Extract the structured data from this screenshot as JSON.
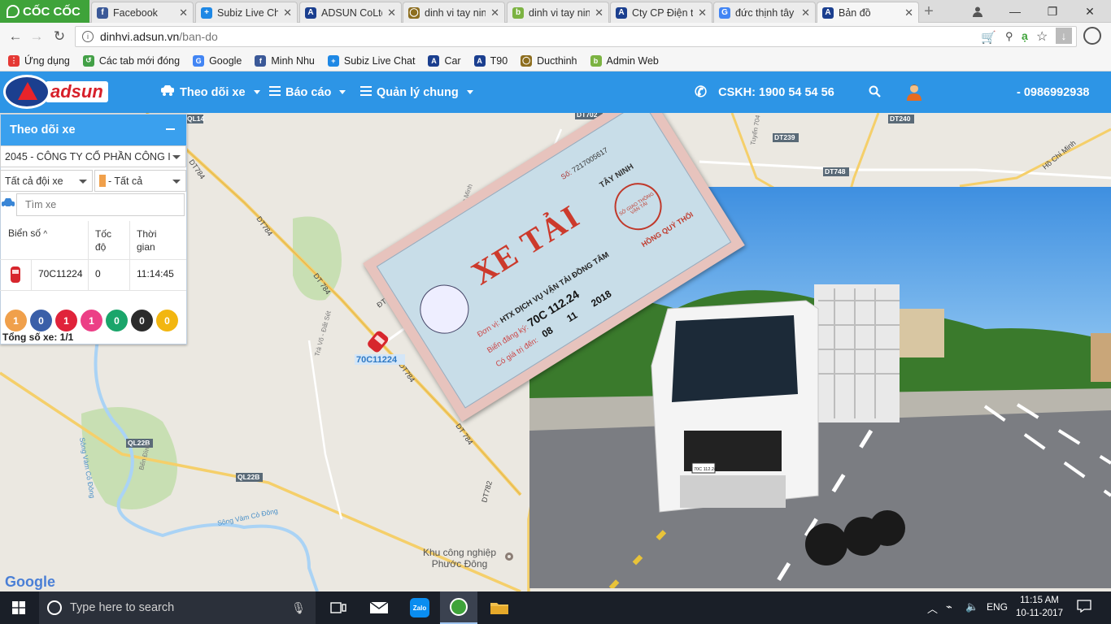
{
  "browser": {
    "brand": "CỐC CỐC",
    "tabs": [
      {
        "title": "Facebook",
        "fav": "f",
        "color": "#3b5998"
      },
      {
        "title": "Subiz Live Ch",
        "fav": "+",
        "color": "#1e88e5"
      },
      {
        "title": "ADSUN CoLtd",
        "fav": "A",
        "color": "#1b3f8f"
      },
      {
        "title": "dinh vi tay nin",
        "fav": "◯",
        "color": "#8d6e1f"
      },
      {
        "title": "dinh vi tay nin",
        "fav": "b",
        "color": "#7cb342"
      },
      {
        "title": "Cty CP Điện tu",
        "fav": "A",
        "color": "#1b3f8f"
      },
      {
        "title": "đức thịnh tây",
        "fav": "G",
        "color": "#4285f4"
      },
      {
        "title": "Bản đồ",
        "fav": "A",
        "color": "#1b3f8f"
      }
    ],
    "url_host": "dinhvi.adsun.vn",
    "url_path": "/ban-do",
    "bookmarks": [
      {
        "label": "Ứng dụng",
        "fav": "⋮",
        "color": "#e53935"
      },
      {
        "label": "Các tab mới đóng",
        "fav": "↺",
        "color": "#43a047"
      },
      {
        "label": "Google",
        "fav": "G",
        "color": "#4285f4"
      },
      {
        "label": "Minh Nhu",
        "fav": "f",
        "color": "#3b5998"
      },
      {
        "label": "Subiz Live Chat",
        "fav": "+",
        "color": "#1e88e5"
      },
      {
        "label": "Car",
        "fav": "A",
        "color": "#1b3f8f"
      },
      {
        "label": "T90",
        "fav": "A",
        "color": "#1b3f8f"
      },
      {
        "label": "Ducthinh",
        "fav": "◯",
        "color": "#8d6e1f"
      },
      {
        "label": "Admin Web",
        "fav": "b",
        "color": "#7cb342"
      }
    ]
  },
  "site": {
    "logo_text": "adsun",
    "menu": {
      "track": "Theo dõi xe",
      "reports": "Báo cáo",
      "manage": "Quản lý chung"
    },
    "hotline": "CSKH: 1900 54 54 56",
    "phone": "- 0986992938"
  },
  "panel": {
    "title": "Theo dõi xe",
    "company": "2045 - CÔNG TY CỔ PHẦN CÔNG I",
    "group": "Tất cả đội xe",
    "status": "- Tất cả",
    "search_placeholder": "Tìm xe",
    "columns": {
      "plate": "Biển số",
      "speed_1": "Tốc",
      "speed_2": "độ",
      "time_1": "Thời",
      "time_2": "gian"
    },
    "rows": [
      {
        "plate": "70C11224",
        "speed": "0",
        "time": "11:14:45"
      }
    ],
    "badges": [
      {
        "value": "1",
        "color": "#f0a04b"
      },
      {
        "value": "0",
        "color": "#3a5fa8"
      },
      {
        "value": "1",
        "color": "#e0233a"
      },
      {
        "value": "1",
        "color": "#ec3f86"
      },
      {
        "value": "0",
        "color": "#1aa56a"
      },
      {
        "value": "0",
        "color": "#2b2b2b"
      },
      {
        "value": "0",
        "color": "#f2b610"
      }
    ],
    "total": "Tổng số xe: 1/1"
  },
  "map": {
    "roads": [
      "QL14",
      "DT784",
      "DT784",
      "DT 784",
      "DT784",
      "DT 784",
      "DT702",
      "DT239",
      "DT240",
      "DT748",
      "ĐT ĐS",
      "QL22B",
      "QL22B",
      "DT782",
      "Hồ Chí Minh"
    ],
    "vehicle_label": "70C11224",
    "places": [
      "Khu công nghiệp",
      "Phước Đông"
    ],
    "rivers": [
      "Sông Vàm Cỏ Đông",
      "Sông Vàm Cỏ Đông"
    ],
    "streets": [
      "Trà Võ - Đất Sét",
      "Bến Đình",
      "Phước Minh",
      "Tuyến 704"
    ],
    "attribution": "Google"
  },
  "overlay": {
    "card_title": "XE TẢI",
    "card_province": "TÂY NINH",
    "card_number": "7217005617",
    "card_so": "Số:",
    "card_unit_label": "Đơn vị:",
    "card_unit": "HTX DỊCH VỤ VẬN TẢI ĐỒNG TÂM",
    "card_plate_label": "Biển đăng ký:",
    "card_plate": "70C 112.24",
    "card_valid_label": "Có giá trị đến:",
    "card_day": "08",
    "card_month": "11",
    "card_year": "2018",
    "card_signer": "HỒNG QUÝ THỐI",
    "stamp": "SỞ GIAO THÔNG VẬN TẢI",
    "truck_plate": "70C 112.24"
  },
  "taskbar": {
    "search_placeholder": "Type here to search",
    "lang": "ENG",
    "time": "11:15 AM",
    "date": "10-11-2017"
  }
}
